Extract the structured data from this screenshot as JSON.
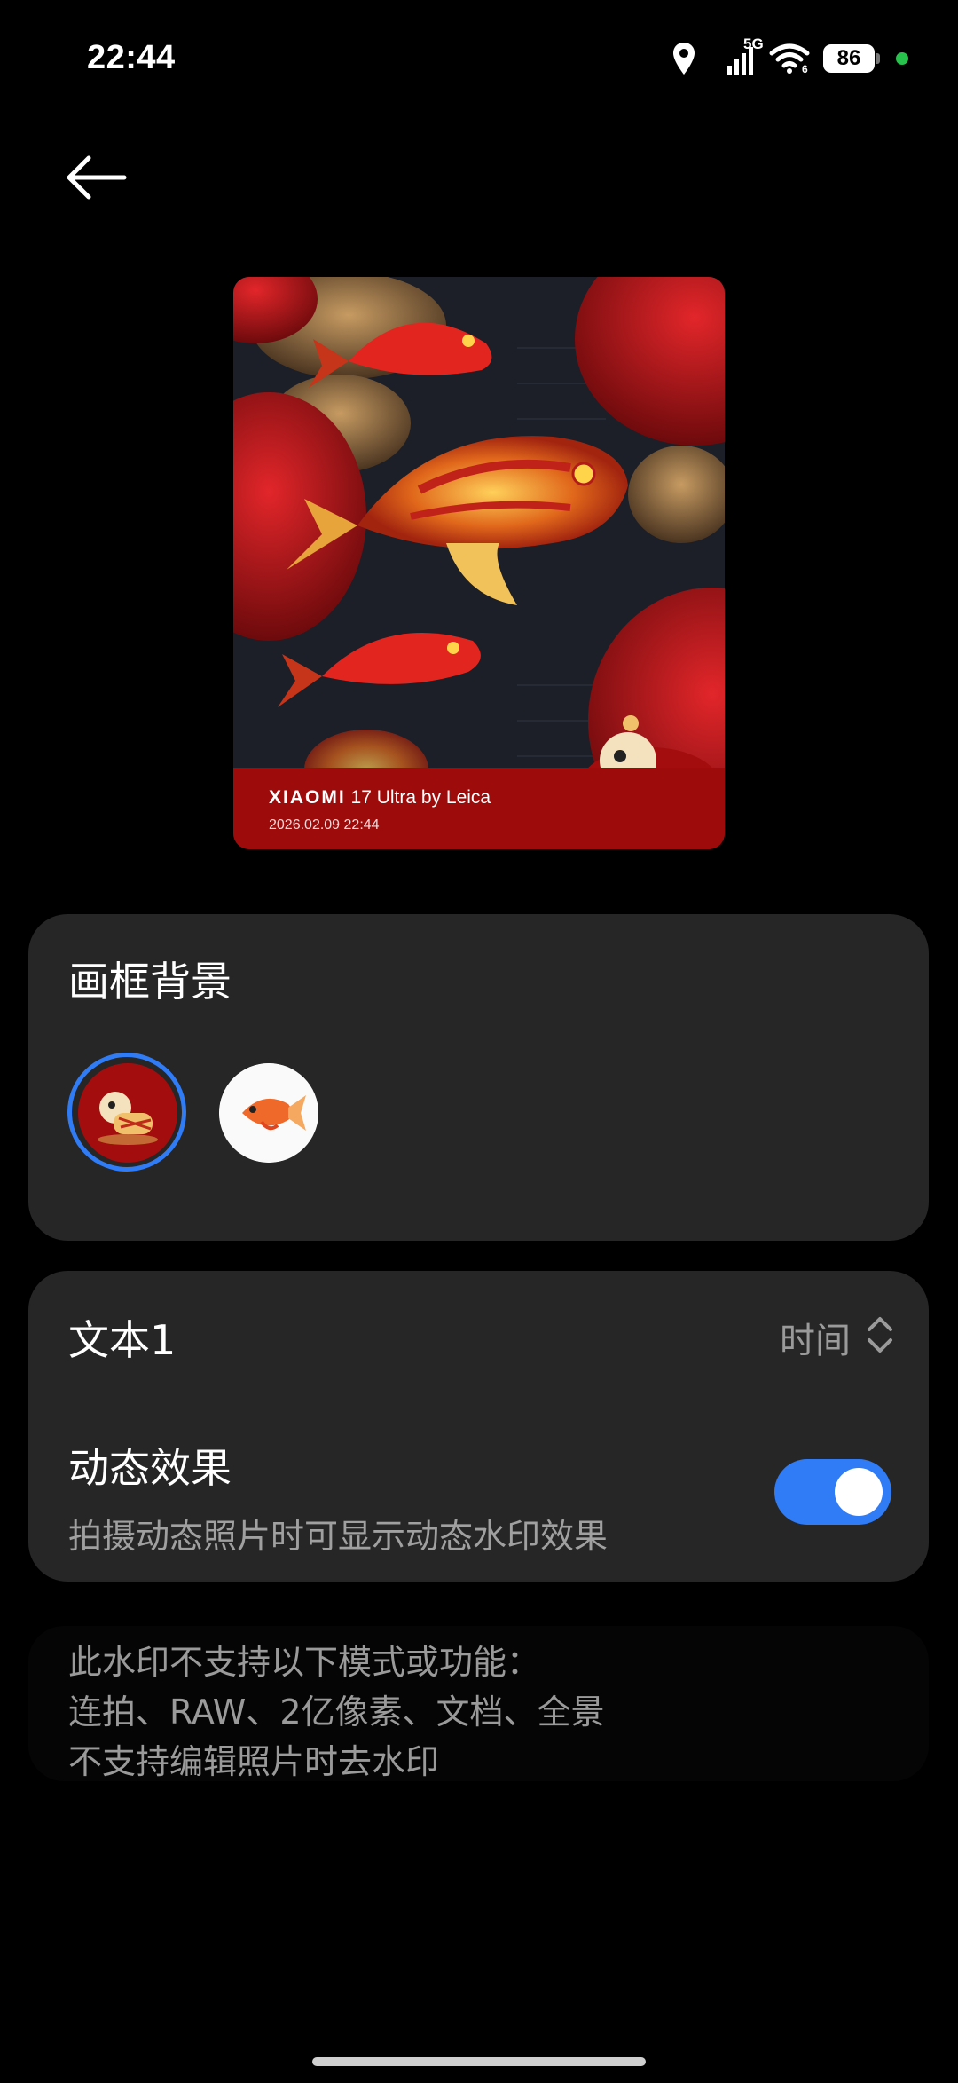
{
  "status_bar": {
    "time": "22:44",
    "network": "5G",
    "battery": "86"
  },
  "preview": {
    "watermark_brand": "XIAOMI",
    "watermark_model": "17 Ultra",
    "watermark_by": "by Leica",
    "watermark_datetime": "2026.02.09 22:44"
  },
  "frame_background": {
    "title": "画框背景",
    "options": [
      {
        "name": "lion-dance-red",
        "selected": true
      },
      {
        "name": "koi-white",
        "selected": false
      }
    ]
  },
  "text_settings": {
    "text1_label": "文本1",
    "text1_value": "时间",
    "dynamic_label": "动态效果",
    "dynamic_desc": "拍摄动态照片时可显示动态水印效果",
    "dynamic_enabled": true
  },
  "notice": {
    "line1": "此水印不支持以下模式或功能：",
    "line2": "连拍、RAW、2亿像素、文档、全景",
    "line3": "不支持编辑照片时去水印"
  },
  "colors": {
    "accent": "#2f7cf6",
    "card": "#262626",
    "watermark_red": "#9e0b0b"
  }
}
